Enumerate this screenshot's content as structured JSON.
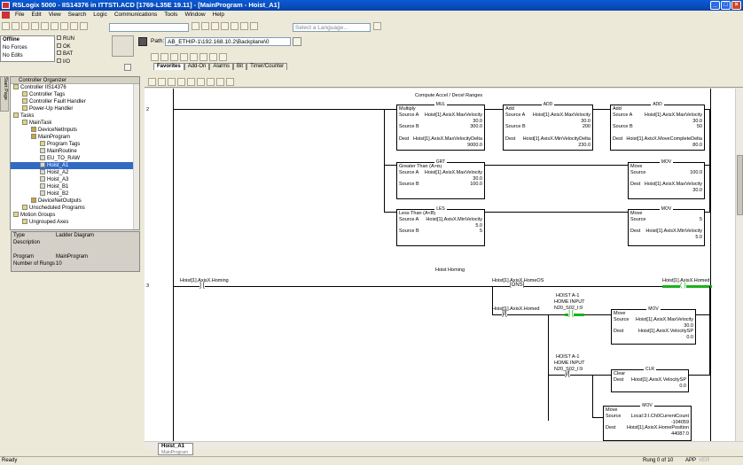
{
  "window": {
    "title": "RSLogix 5000 - IIS14376 in ITTSTI.ACD [1769-L35E 19.11] - [MainProgram - Hoist_A1]"
  },
  "menu": [
    "File",
    "Edit",
    "View",
    "Search",
    "Logic",
    "Communications",
    "Tools",
    "Window",
    "Help"
  ],
  "toolbar": {
    "language_placeholder": "Select a Language...",
    "path_label": "Path:",
    "path_value": "AB_ETHIP-1\\192.168.10.2\\Backplane\\0"
  },
  "status": {
    "mode": "Offline",
    "forces": "No Forces",
    "edits": "No Edits",
    "run": "RUN",
    "ok": "OK",
    "bat": "BAT",
    "io": "I/O"
  },
  "instr_tabs": [
    "Favorites",
    "Add-On",
    "Alarms",
    "Bit",
    "Timer/Counter"
  ],
  "organizer": {
    "title": "Controller Organizer",
    "items": [
      {
        "label": "Controller IIS14376",
        "depth": 0,
        "icon": "folder"
      },
      {
        "label": "Controller Tags",
        "depth": 1,
        "icon": "tags"
      },
      {
        "label": "Controller Fault Handler",
        "depth": 1,
        "icon": "folder"
      },
      {
        "label": "Power-Up Handler",
        "depth": 1,
        "icon": "folder"
      },
      {
        "label": "Tasks",
        "depth": 0,
        "icon": "folder"
      },
      {
        "label": "MainTask",
        "depth": 1,
        "icon": "task"
      },
      {
        "label": "DeviceNetInputs",
        "depth": 2,
        "icon": "program"
      },
      {
        "label": "MainProgram",
        "depth": 2,
        "icon": "program"
      },
      {
        "label": "Program Tags",
        "depth": 3,
        "icon": "tags"
      },
      {
        "label": "MainRoutine",
        "depth": 3,
        "icon": "routine"
      },
      {
        "label": "EU_TO_RAW",
        "depth": 3,
        "icon": "routine"
      },
      {
        "label": "Hoist_A1",
        "depth": 3,
        "icon": "routine",
        "selected": true
      },
      {
        "label": "Hoist_A2",
        "depth": 3,
        "icon": "routine"
      },
      {
        "label": "Hoist_A3",
        "depth": 3,
        "icon": "routine"
      },
      {
        "label": "Hoist_B1",
        "depth": 3,
        "icon": "routine"
      },
      {
        "label": "Hoist_B2",
        "depth": 3,
        "icon": "routine"
      },
      {
        "label": "DeviceNetOutputs",
        "depth": 2,
        "icon": "program"
      },
      {
        "label": "Unscheduled Programs",
        "depth": 1,
        "icon": "folder"
      },
      {
        "label": "Motion Groups",
        "depth": 0,
        "icon": "folder"
      },
      {
        "label": "Ungrouped Axes",
        "depth": 1,
        "icon": "folder"
      }
    ]
  },
  "properties": [
    {
      "k": "Type",
      "v": "Ladder Diagram"
    },
    {
      "k": "Description",
      "v": ""
    },
    {
      "k": "",
      "v": ""
    },
    {
      "k": "Program",
      "v": "MainProgram"
    },
    {
      "k": "Number of Rungs",
      "v": "10"
    }
  ],
  "rung2": {
    "number": "2",
    "comment": "Compute Accel / Decel Ranges",
    "mul": {
      "type": "MUL",
      "name": "Multiply",
      "srcA_label": "Source A",
      "srcA": "Hoist[1].AxisX.MaxVelocity",
      "srcA_val": "30.0",
      "srcB_label": "Source B",
      "srcB": "300.0",
      "dest_label": "Dest",
      "dest": "Hoist[1].AxisX.MaxVelocityDelta",
      "dest_val": "9000.0"
    },
    "add1": {
      "type": "ADD",
      "name": "Add",
      "srcA_label": "Source A",
      "srcA": "Hoist[1].AxisX.MaxVelocity",
      "srcA_val": "30.0",
      "srcB_label": "Source B",
      "srcB": "200",
      "dest_label": "Dest",
      "dest": "Hoist[1].AxisX.MinVelocityDelta",
      "dest_val": "230.0"
    },
    "add2": {
      "type": "ADD",
      "name": "Add",
      "srcA_label": "Source A",
      "srcA": "Hoist[1].AxisX.MaxVelocity",
      "srcA_val": "30.0",
      "srcB_label": "Source B",
      "srcB": "50",
      "dest_label": "Dest",
      "dest": "Hoist[1].AxisX.MoveCompleteDelta",
      "dest_val": "80.0"
    },
    "grt": {
      "type": "GRT",
      "name": "Greater Than (A>B)",
      "srcA_label": "Source A",
      "srcA": "Hoist[1].AxisX.MaxVelocity",
      "srcA_val": "30.0",
      "srcB_label": "Source B",
      "srcB": "100.0"
    },
    "mov1": {
      "type": "MOV",
      "name": "Move",
      "src_label": "Source",
      "src": "100.0",
      "dest_label": "Dest",
      "dest": "Hoist[1].AxisX.MaxVelocity",
      "dest_val": "30.0"
    },
    "les": {
      "type": "LES",
      "name": "Less Than (A<B)",
      "srcA_label": "Source A",
      "srcA": "Hoist[1].AxisX.MinVelocity",
      "srcA_val": "5.0",
      "srcB_label": "Source B",
      "srcB": "5"
    },
    "mov2": {
      "type": "MOV",
      "name": "Move",
      "src_label": "Source",
      "src": "5",
      "dest_label": "Dest",
      "dest": "Hoist[1].AxisX.MinVelocity",
      "dest_val": "5.0"
    }
  },
  "rung3": {
    "number": "3",
    "comment": "Hoist Homing",
    "xic_homing": "Hoist[1].AxisX.Homing",
    "ons": "Hoist[1].AxisX.HomeOS",
    "ons_type": "ONS",
    "ote_homed": "Hoist[1].AxisX.Homed",
    "xio_homed": "Hoist[1].AxisX.Homed",
    "home_in1_a": "HOIST A-1",
    "home_in1_b": "HOME INPUT",
    "home_in1_c": "N20_S02_I:9",
    "home_in2_a": "HOIST A-1",
    "home_in2_b": "HOME INPUT",
    "home_in2_c": "N20_S02_I:9",
    "mov3": {
      "type": "MOV",
      "name": "Move",
      "src_label": "Source",
      "src": "Hoist[1].AxisX.MaxVelocity",
      "src_val": "30.0",
      "dest_label": "Dest",
      "dest": "Hoist[1].AxisX.VelocitySP",
      "dest_val": "0.0"
    },
    "clr": {
      "type": "CLR",
      "name": "Clear",
      "dest_label": "Dest",
      "dest": "Hoist[1].AxisX.VelocitySP",
      "dest_val": "0.0"
    },
    "mov4": {
      "type": "MOV",
      "name": "Move",
      "src_label": "Source",
      "src": "Local:3:I.Ch0CurrentCount",
      "src_val": "-104059",
      "dest_label": "Dest",
      "dest": "Hoist[1].AxisX.HomePosition",
      "dest_val": "44087.0"
    }
  },
  "sheet_tab": "Hoist_A1",
  "sheet_sub": "MainProgram",
  "statusbar": {
    "left": "Ready",
    "rung": "Rung 0 of 10",
    "app": "APP",
    "ver": "VER"
  },
  "startpage": "Start Page"
}
